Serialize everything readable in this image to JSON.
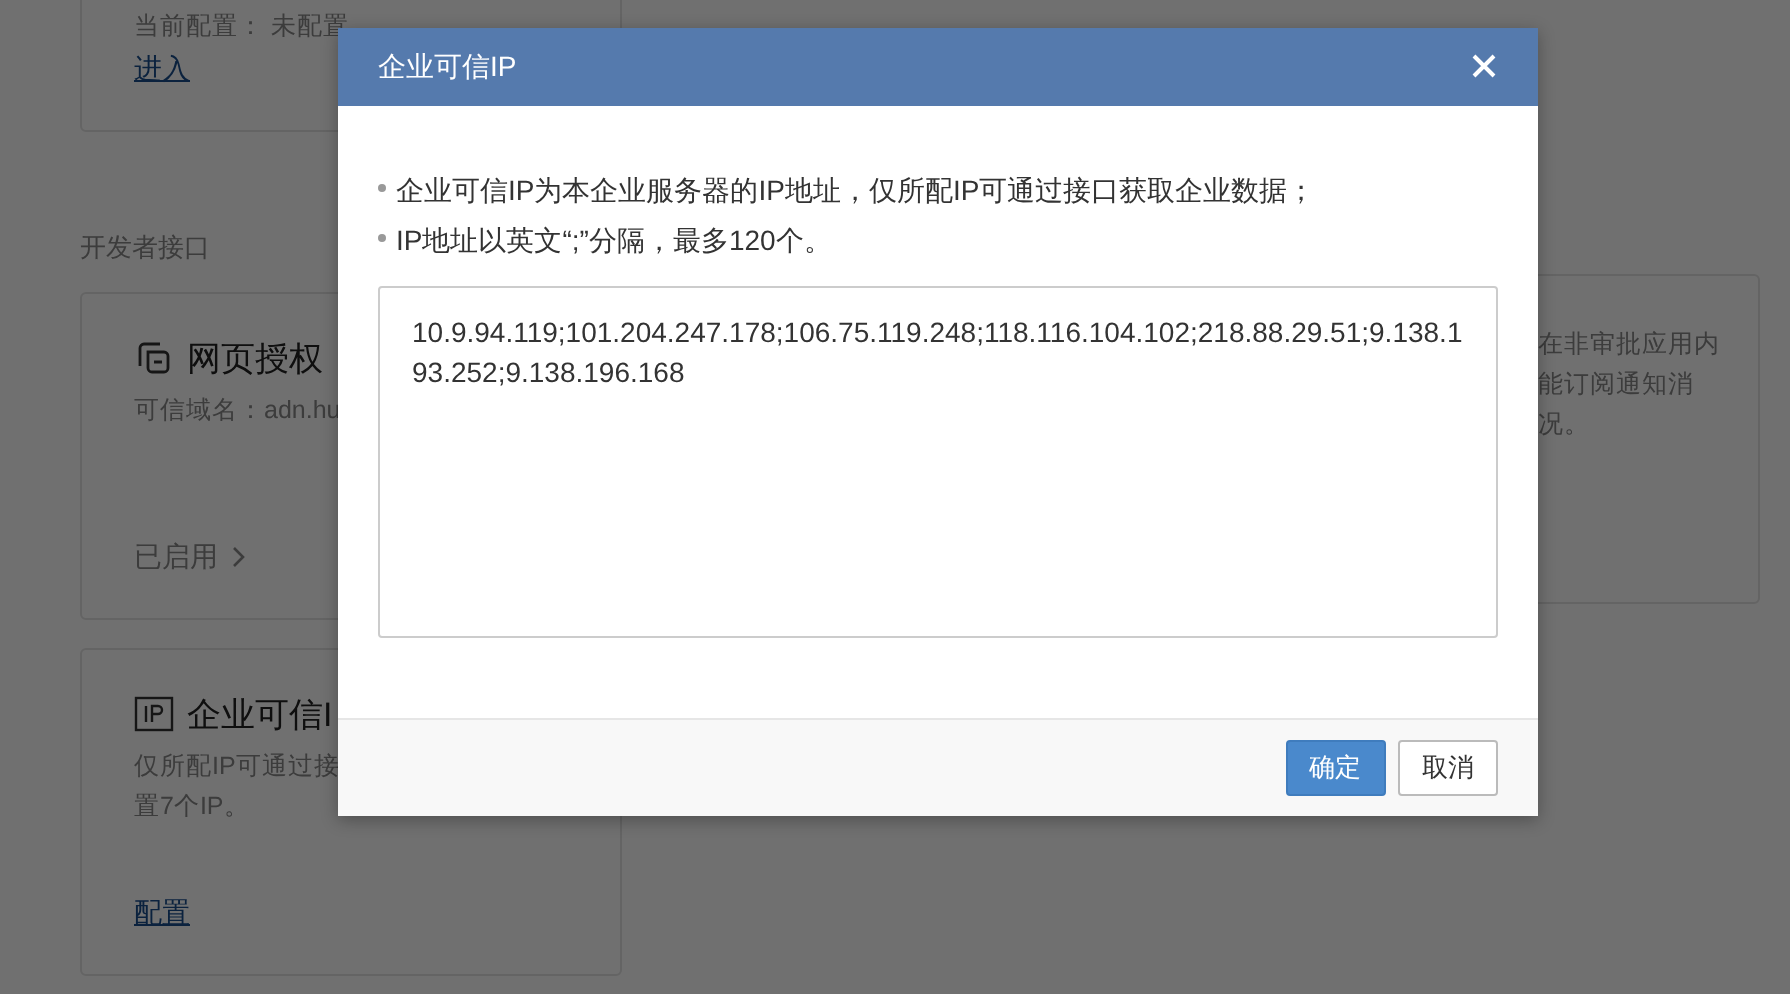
{
  "page": {
    "cards": [
      {
        "kind": "config",
        "lines": [
          "当前配置： 未配置"
        ],
        "footer": "进入"
      },
      {
        "kind": "web",
        "section": "开发者接口",
        "title": "网页授权",
        "lines": [
          "可信域名：adn.hu"
        ],
        "footer": "已启用"
      },
      {
        "kind": "ip",
        "title": "企业可信I",
        "lines": [
          "仅所配IP可通过接",
          "置7个IP。"
        ],
        "footer": "配置"
      }
    ],
    "right_card": {
      "lines": [
        "在非审批应用内",
        "能订阅通知消",
        "况。"
      ]
    }
  },
  "modal": {
    "title": "企业可信IP",
    "notes": [
      "企业可信IP为本企业服务器的IP地址，仅所配IP可通过接口获取企业数据；",
      "IP地址以英文“;”分隔，最多120个。"
    ],
    "ip_list": {
      "value": "10.9.94.119;101.204.247.178;106.75.119.248;118.116.104.102;218.88.29.51;9.138.193.252;9.138.196.168"
    },
    "buttons": [
      {
        "label": "确定",
        "primary": true
      },
      {
        "label": "取消",
        "primary": false
      }
    ]
  }
}
